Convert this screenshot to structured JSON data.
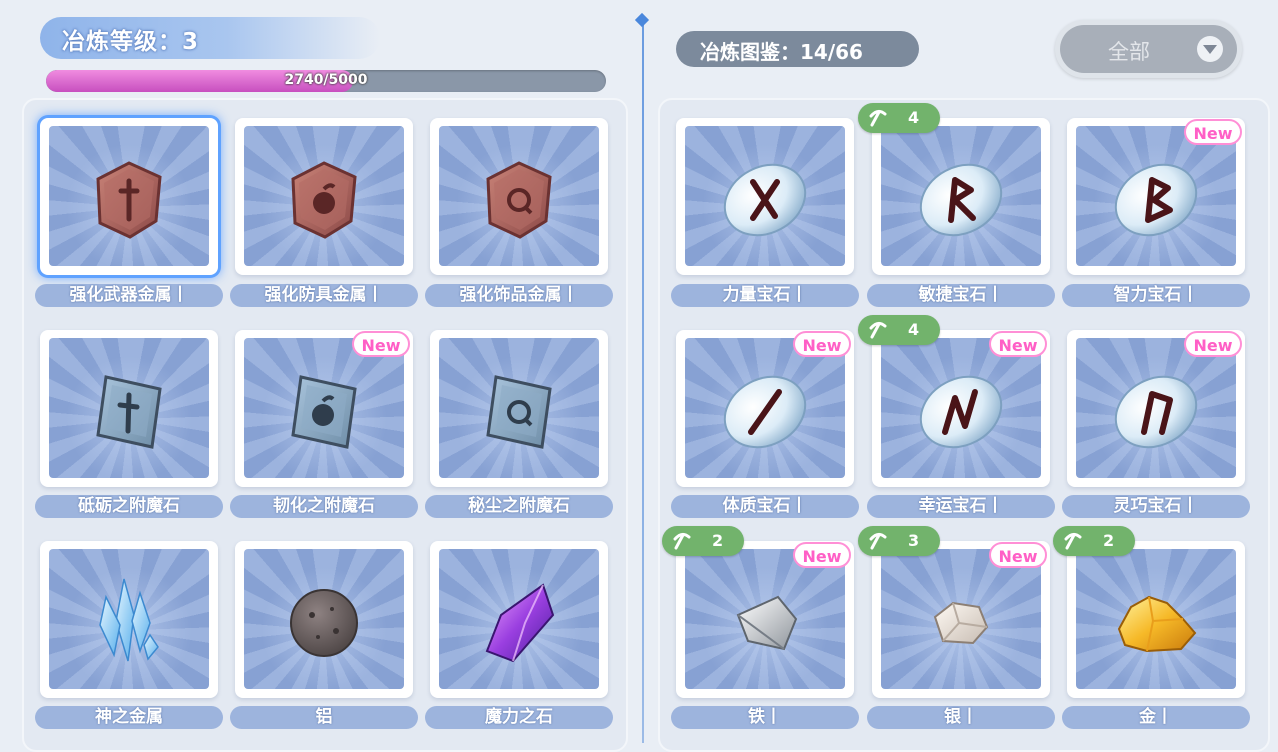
{
  "header": {
    "level_text": "冶炼等级：3",
    "exp_text": "2740/5000",
    "exp_progress": 0.548,
    "codex_text": "冶炼图鉴：14/66",
    "filter_label": "全部"
  },
  "left_items": [
    {
      "label": "强化武器金属丨",
      "icon": "weapon-metal-icon",
      "new": "",
      "selected": true
    },
    {
      "label": "强化防具金属丨",
      "icon": "armor-metal-icon",
      "new": ""
    },
    {
      "label": "强化饰品金属丨",
      "icon": "accessory-metal-icon",
      "new": ""
    },
    {
      "label": "砥砺之附魔石",
      "icon": "weapon-enchant-stone-icon",
      "new": ""
    },
    {
      "label": "韧化之附魔石",
      "icon": "armor-enchant-stone-icon",
      "new": "New"
    },
    {
      "label": "秘尘之附魔石",
      "icon": "accessory-enchant-stone-icon",
      "new": ""
    },
    {
      "label": "神之金属",
      "icon": "blue-crystal-icon",
      "new": ""
    },
    {
      "label": "铝",
      "icon": "aluminum-ore-icon",
      "new": ""
    },
    {
      "label": "魔力之石",
      "icon": "purple-crystal-icon",
      "new": ""
    }
  ],
  "right_items": [
    {
      "label": "力量宝石丨",
      "icon": "strength-rune-gem-icon",
      "new": "",
      "count": ""
    },
    {
      "label": "敏捷宝石丨",
      "icon": "agility-rune-gem-icon",
      "new": "",
      "count": "4"
    },
    {
      "label": "智力宝石丨",
      "icon": "intellect-rune-gem-icon",
      "new": "New",
      "count": ""
    },
    {
      "label": "体质宝石丨",
      "icon": "constitution-rune-gem-icon",
      "new": "New",
      "count": ""
    },
    {
      "label": "幸运宝石丨",
      "icon": "luck-rune-gem-icon",
      "new": "New",
      "count": "4"
    },
    {
      "label": "灵巧宝石丨",
      "icon": "dexterity-rune-gem-icon",
      "new": "New",
      "count": ""
    },
    {
      "label": "铁丨",
      "icon": "iron-ore-icon",
      "new": "New",
      "count": "2"
    },
    {
      "label": "银丨",
      "icon": "silver-ore-icon",
      "new": "New",
      "count": "3"
    },
    {
      "label": "金丨",
      "icon": "gold-ore-icon",
      "new": "",
      "count": "2"
    }
  ],
  "colors": {
    "exp_fill": "#d65ccc",
    "new_badge": "#ff5fc6",
    "count_badge": "#72b36c",
    "selection": "#5fa2ff"
  }
}
